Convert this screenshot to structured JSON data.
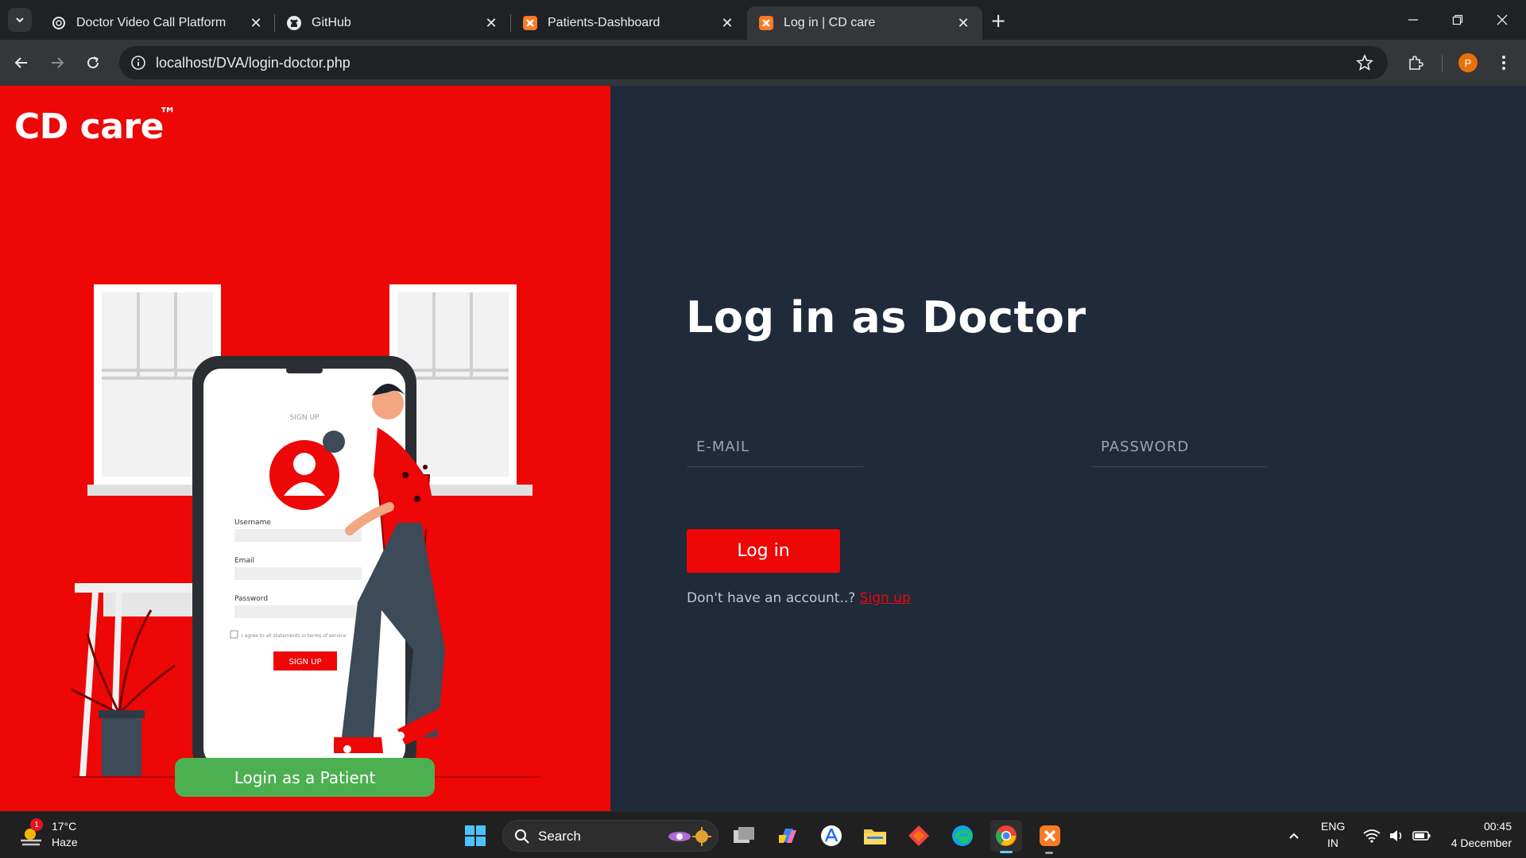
{
  "browser": {
    "tabs": [
      {
        "title": "Doctor Video Call Platform",
        "icon": "openai-icon"
      },
      {
        "title": "GitHub",
        "icon": "github-icon"
      },
      {
        "title": "Patients-Dashboard",
        "icon": "xampp-icon"
      },
      {
        "title": "Log in | CD care",
        "icon": "xampp-icon",
        "active": true
      }
    ],
    "url": "localhost/DVA/login-doctor.php",
    "profile_initial": "P"
  },
  "left_panel": {
    "brand": "CD care",
    "trademark": "™",
    "illustration": {
      "phone_title": "SIGN UP",
      "username_label": "Username",
      "email_label": "Email",
      "password_label": "Password",
      "agree_text": "I agree to all statements in terms of service",
      "phone_button": "SIGN UP"
    },
    "patient_button": "Login as a Patient",
    "colors": {
      "background": "#ed0707",
      "patient_button": "#4caf50"
    }
  },
  "right_panel": {
    "heading": "Log in as Doctor",
    "email_placeholder": "E-MAIL",
    "password_placeholder": "PASSWORD",
    "login_button": "Log in",
    "no_account_text": "Don't have an account..?",
    "signup_link": "Sign up",
    "colors": {
      "background": "#1f2a3b",
      "accent": "#ed0707"
    }
  },
  "taskbar": {
    "weather_temp": "17°C",
    "weather_condition": "Haze",
    "weather_badge": "1",
    "search_label": "Search",
    "language_top": "ENG",
    "language_bottom": "IN",
    "time": "00:45",
    "date": "4 December"
  }
}
